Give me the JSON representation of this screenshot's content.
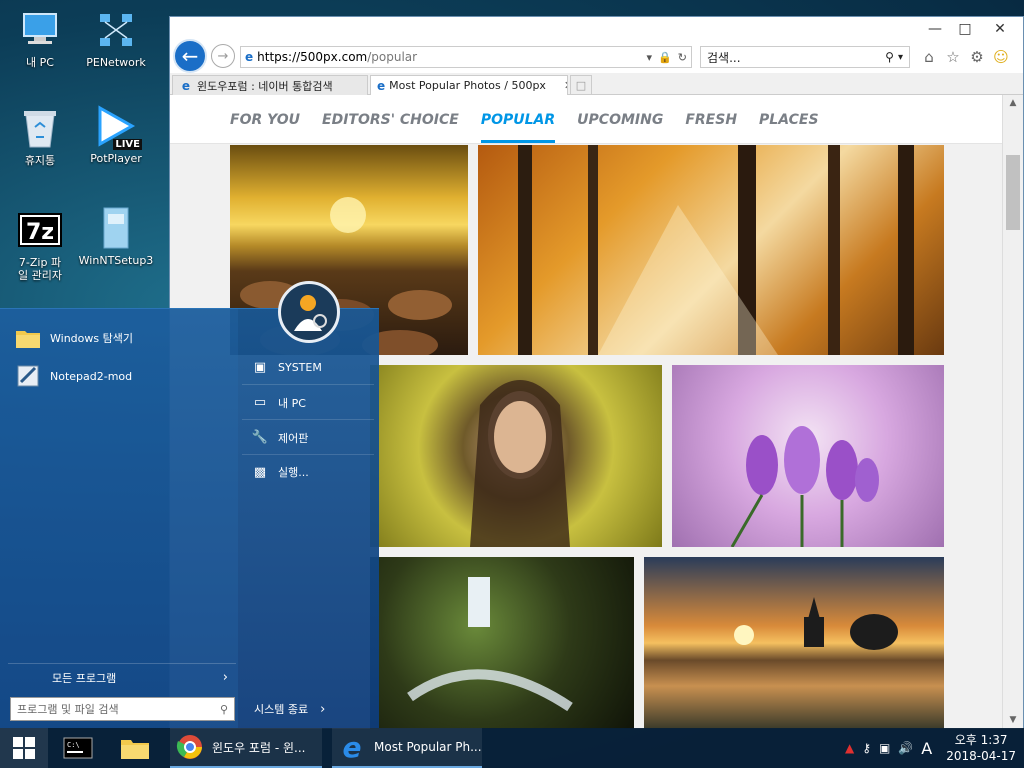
{
  "desktop": {
    "icons": [
      {
        "label": "내 PC"
      },
      {
        "label": "PENetwork"
      },
      {
        "label": "휴지통"
      },
      {
        "label": "PotPlayer"
      },
      {
        "label": "7-Zip 파일 관리자"
      },
      {
        "label": "WinNTSetup3"
      }
    ],
    "potplayer_badge": "LIVE"
  },
  "browser": {
    "url_domain": "https://500px.com",
    "url_path": "/popular",
    "search_placeholder": "검색...",
    "tabs": [
      {
        "label": "윈도우포럼 : 네이버 통합검색"
      },
      {
        "label": "Most Popular Photos / 500px"
      }
    ],
    "page_nav": [
      "FOR YOU",
      "EDITORS' CHOICE",
      "POPULAR",
      "UPCOMING",
      "FRESH",
      "PLACES"
    ],
    "active_nav": "POPULAR",
    "accent_color": "#0096e6"
  },
  "start_menu": {
    "pinned": [
      {
        "label": "Windows 탐색기"
      },
      {
        "label": "Notepad2-mod"
      }
    ],
    "right_items": [
      {
        "label": "SYSTEM"
      },
      {
        "label": "내 PC"
      },
      {
        "label": "제어판"
      },
      {
        "label": "실행..."
      }
    ],
    "all_programs": "모든 프로그램",
    "search_placeholder": "프로그램 및 파일 검색",
    "shutdown": "시스템 종료"
  },
  "taskbar": {
    "apps": [
      {
        "label": "윈도우 포럼 - 윈..."
      },
      {
        "label": "Most Popular Ph..."
      }
    ],
    "ime": "A",
    "time": "오후 1:37",
    "date": "2018-04-17"
  }
}
